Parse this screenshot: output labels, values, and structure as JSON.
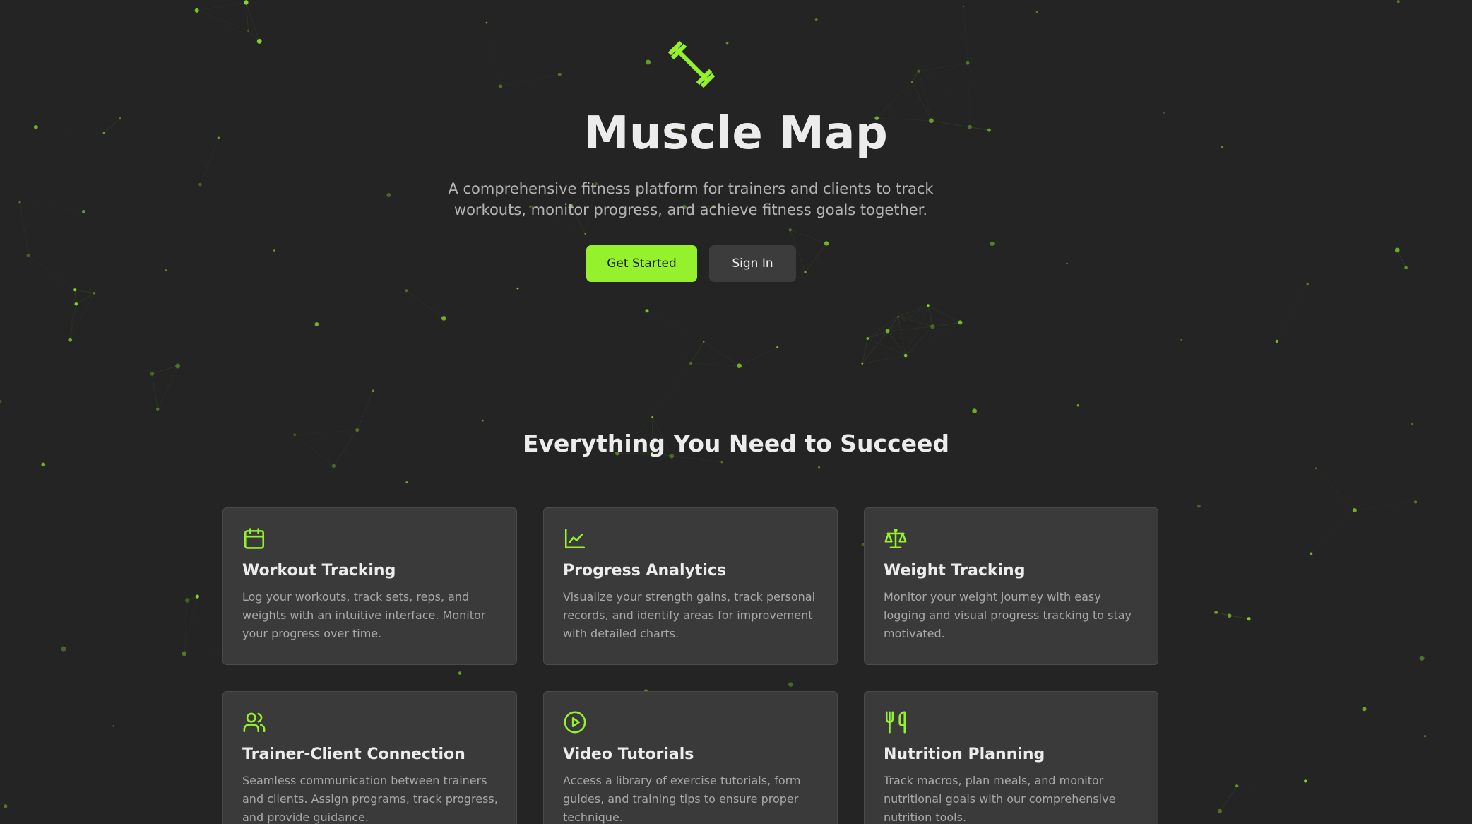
{
  "hero": {
    "logo_icon": "barbell-icon",
    "title": "Muscle Map",
    "subtitle": "A comprehensive fitness platform for trainers and clients to track workouts, monitor progress, and achieve fitness goals together.",
    "primary_button": "Get Started",
    "secondary_button": "Sign In"
  },
  "features": {
    "heading": "Everything You Need to Succeed",
    "items": [
      {
        "icon": "calendar-icon",
        "title": "Workout Tracking",
        "description": "Log your workouts, track sets, reps, and weights with an intuitive interface. Monitor your progress over time."
      },
      {
        "icon": "line-chart-icon",
        "title": "Progress Analytics",
        "description": "Visualize your strength gains, track personal records, and identify areas for improvement with detailed charts."
      },
      {
        "icon": "scale-icon",
        "title": "Weight Tracking",
        "description": "Monitor your weight journey with easy logging and visual progress tracking to stay motivated."
      },
      {
        "icon": "users-icon",
        "title": "Trainer-Client Connection",
        "description": "Seamless communication between trainers and clients. Assign programs, track progress, and provide guidance."
      },
      {
        "icon": "play-circle-icon",
        "title": "Video Tutorials",
        "description": "Access a library of exercise tutorials, form guides, and training tips to ensure proper technique."
      },
      {
        "icon": "utensils-icon",
        "title": "Nutrition Planning",
        "description": "Track macros, plan meals, and monitor nutritional goals with our comprehensive nutrition tools."
      }
    ]
  },
  "colors": {
    "background": "#242424",
    "accent": "#95f12b",
    "card": "#3a3a3a",
    "secondary_button": "#3c3c3c"
  }
}
